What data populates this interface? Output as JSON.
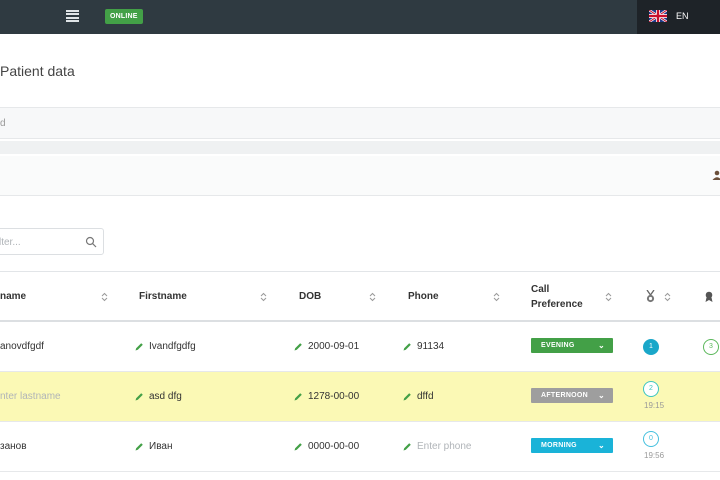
{
  "topbar": {
    "status_badge": "ONLINE",
    "language": "EN",
    "icons": [
      "menu-icon",
      "uk-flag-icon"
    ]
  },
  "page": {
    "title": "Patient data",
    "bar_text": "d"
  },
  "filter": {
    "placeholder": "lter..."
  },
  "table": {
    "columns": [
      "name",
      "Firstname",
      "DOB",
      "Phone",
      "Call Preference"
    ],
    "rows": [
      {
        "lastname": "anovdfgdf",
        "firstname": "Ivandfgdfg",
        "dob": "2000-09-01",
        "phone": "91134",
        "preference": "EVENING",
        "count": "1",
        "time": "",
        "extra": "3"
      },
      {
        "lastname": "nter lastname",
        "firstname": "asd dfg",
        "dob": "1278-00-00",
        "phone": "dffd",
        "preference": "AFTERNOON",
        "count": "2",
        "time": "19:15",
        "extra": ""
      },
      {
        "lastname": "занов",
        "firstname": "Иван",
        "dob": "0000-00-00",
        "phone": "Enter phone",
        "preference": "MORNING",
        "count": "0",
        "time": "19:56",
        "extra": ""
      }
    ]
  },
  "colors": {
    "topbar": "#2f3a41",
    "online": "#43a047",
    "evening": "#43a047",
    "afternoon": "#9e9e9e",
    "morning": "#1ab3d8",
    "highlight_row": "#fbf9b5"
  }
}
